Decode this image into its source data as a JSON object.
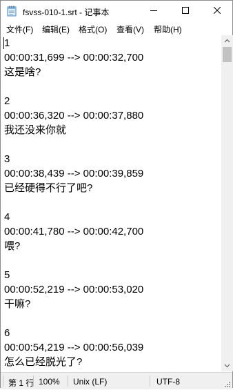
{
  "window": {
    "title": "fsvss-010-1.srt - 记事本"
  },
  "menu": [
    {
      "label": "文件(F)"
    },
    {
      "label": "编辑(E)"
    },
    {
      "label": "格式(O)"
    },
    {
      "label": "查看(V)"
    },
    {
      "label": "帮助(H)"
    }
  ],
  "editor": {
    "lines": [
      "1",
      "00:00:31,699 --> 00:00:32,700",
      "这是啥?",
      "",
      "2",
      "00:00:36,320 --> 00:00:37,880",
      "我还没来你就",
      "",
      "3",
      "00:00:38,439 --> 00:00:39,859",
      "已经硬得不行了吧?",
      "",
      "4",
      "00:00:41,780 --> 00:00:42,700",
      "喂?",
      "",
      "5",
      "00:00:52,219 --> 00:00:53,020",
      "干嘛?",
      "",
      "6",
      "00:00:54,219 --> 00:00:56,039",
      "怎么已经脱光了?"
    ]
  },
  "statusbar": {
    "position": "第 1 行",
    "zoom": "100%",
    "line_ending": "Unix (LF)",
    "encoding": "UTF-8"
  },
  "icons": {
    "app": "notepad-icon",
    "minimize": "minimize-icon",
    "maximize": "maximize-icon",
    "close": "close-icon"
  }
}
